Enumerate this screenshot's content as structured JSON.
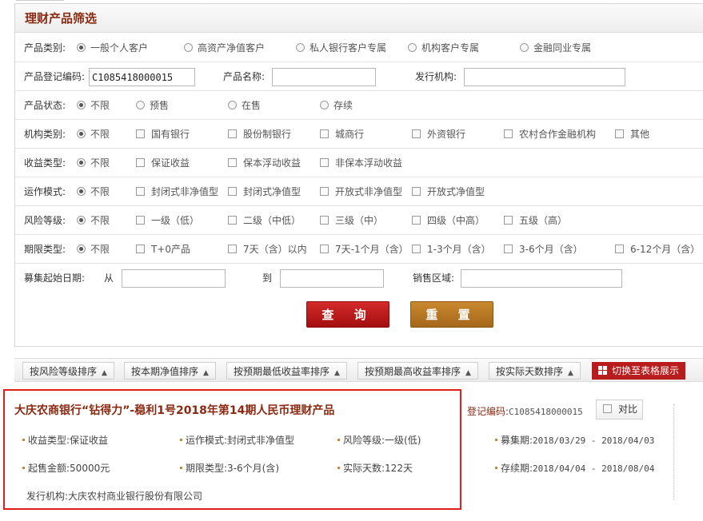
{
  "panel": {
    "title": "理财产品筛选"
  },
  "product_category": {
    "label": "产品类别:",
    "options": [
      "一般个人客户",
      "高资产净值客户",
      "私人银行客户专属",
      "机构客户专属",
      "金融同业专属"
    ]
  },
  "text_fields": {
    "reg_code_label": "产品登记编码:",
    "reg_code_value": "C1085418000015",
    "name_label": "产品名称:",
    "name_value": "",
    "issuer_label": "发行机构:",
    "issuer_value": ""
  },
  "product_status": {
    "label": "产品状态:",
    "options": [
      "不限",
      "预售",
      "在售",
      "存续"
    ]
  },
  "institution_type": {
    "label": "机构类别:",
    "options": [
      "不限",
      "国有银行",
      "股份制银行",
      "城商行",
      "外资银行",
      "农村合作金融机构",
      "其他"
    ]
  },
  "income_type": {
    "label": "收益类型:",
    "options": [
      "不限",
      "保证收益",
      "保本浮动收益",
      "非保本浮动收益"
    ]
  },
  "operation_mode": {
    "label": "运作模式:",
    "options": [
      "不限",
      "封闭式非净值型",
      "封闭式净值型",
      "开放式非净值型",
      "开放式净值型"
    ]
  },
  "risk_level": {
    "label": "风险等级:",
    "options": [
      "不限",
      "一级（低）",
      "二级（中低）",
      "三级（中）",
      "四级（中高）",
      "五级（高）"
    ]
  },
  "term_type": {
    "label": "期限类型:",
    "options": [
      "不限",
      "T+0产品",
      "7天（含）以内",
      "7天-1个月（含）",
      "1-3个月（含）",
      "3-6个月（含）",
      "6-12个月（含）"
    ]
  },
  "raise_date": {
    "label": "募集起始日期:",
    "from_label": "从",
    "to_label": "到",
    "region_label": "销售区域:",
    "from_value": "",
    "to_value": "",
    "region_value": ""
  },
  "buttons": {
    "query": "查 询",
    "reset": "重 置"
  },
  "sort_bar": {
    "items": [
      "按风险等级排序",
      "按本期净值排序",
      "按预期最低收益率排序",
      "按预期最高收益率排序",
      "按实际天数排序"
    ],
    "switch_label": "切换至表格展示"
  },
  "result": {
    "title": "大庆农商银行“钻得力”-稳利1号2018年第14期人民币理财产品",
    "reg_code_label": "登记编码:",
    "reg_code_value": "C1085418000015",
    "compare_label": "对比",
    "income_type": "收益类型:保证收益",
    "operation_mode": "运作模式:封闭式非净值型",
    "risk_level": "风险等级:一级(低)",
    "raise_period_label": "募集期:",
    "raise_period_value": "2018/03/29 - 2018/04/03",
    "min_amount": "起售金额:50000元",
    "term_type": "期限类型:3-6个月(含)",
    "actual_days": "实际天数:122天",
    "duration_label": "存续期:",
    "duration_value": "2018/04/04 - 2018/08/04",
    "issuer": "发行机构:大庆农村商业银行股份有限公司"
  }
}
